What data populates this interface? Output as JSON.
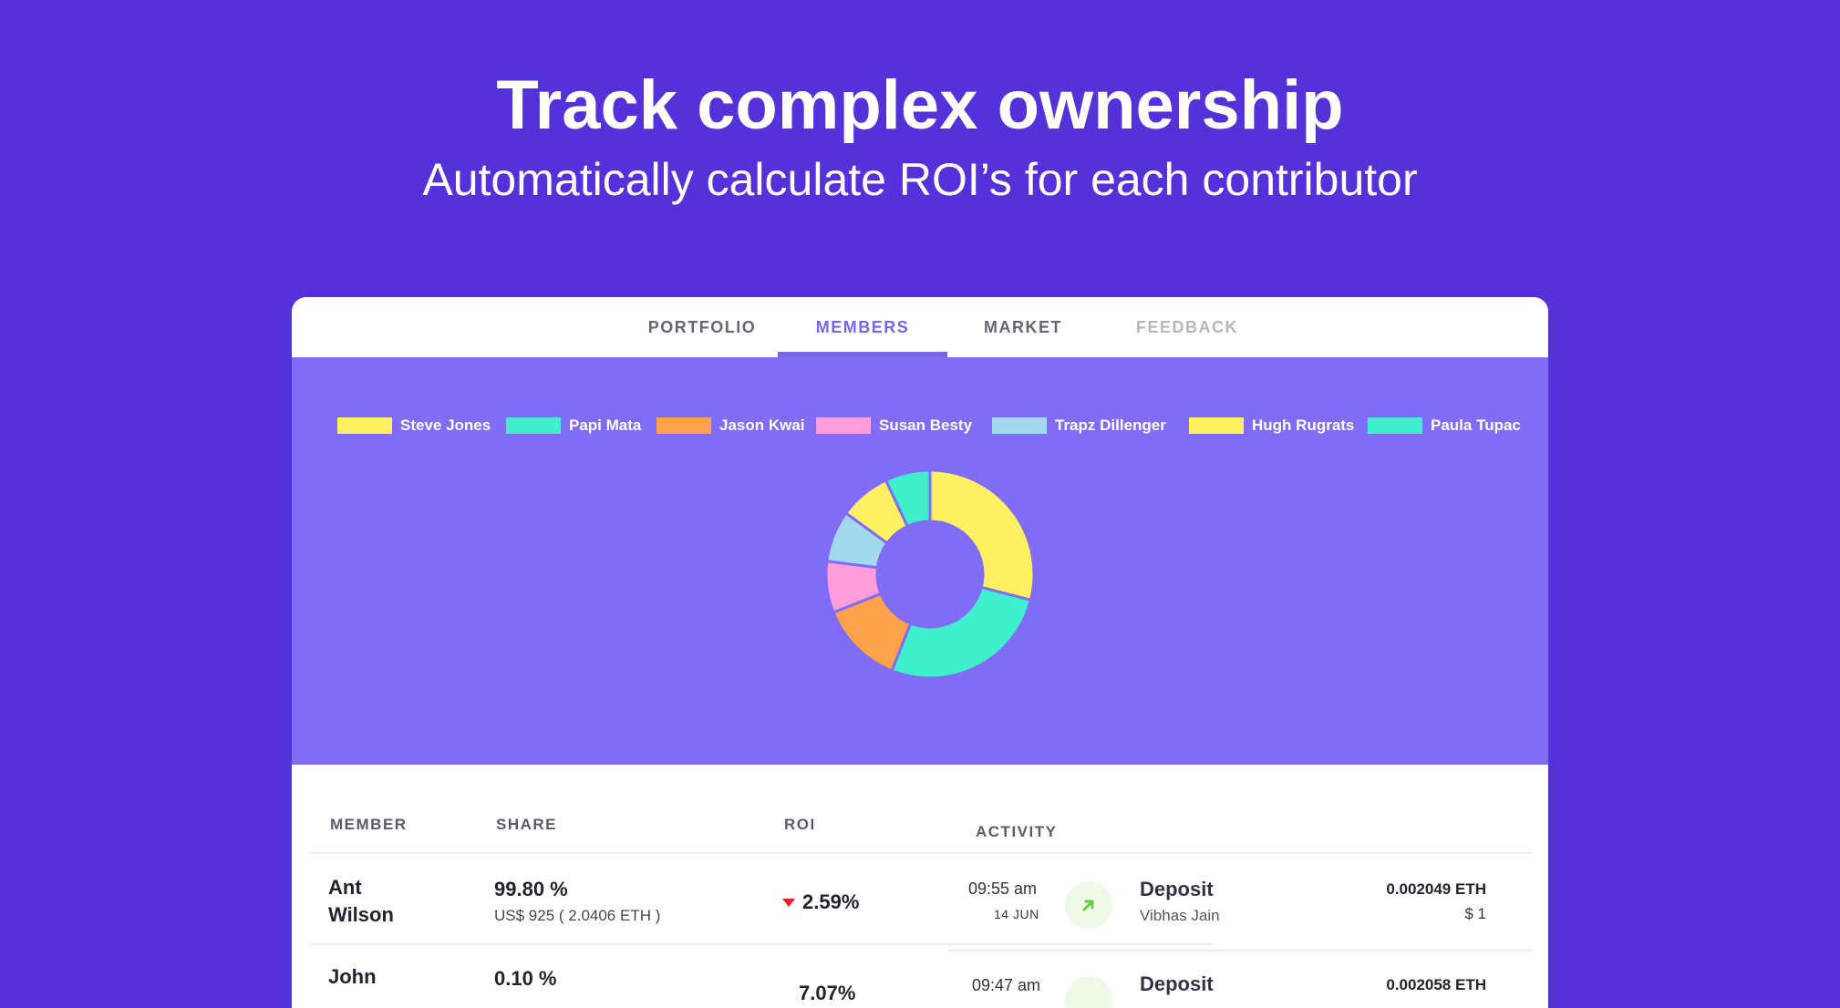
{
  "hero": {
    "title": "Track complex ownership",
    "subtitle": "Automatically calculate ROI’s for each contributor"
  },
  "tabs": [
    {
      "label": "PORTFOLIO"
    },
    {
      "label": "MEMBERS",
      "active": true
    },
    {
      "label": "MARKET"
    },
    {
      "label": "FEEDBACK",
      "muted": true
    }
  ],
  "colors": {
    "background": "#5431d8",
    "accent": "#7b63ef",
    "panel": "#806cf5",
    "roi_down": "#e0202a",
    "deposit_arrow": "#66cc44"
  },
  "chart_data": {
    "type": "pie",
    "variant": "donut",
    "legend_position": "top",
    "series": [
      {
        "name": "Steve Jones",
        "value": 29,
        "color": "#fff064"
      },
      {
        "name": "Papi Mata",
        "value": 27,
        "color": "#3ef0cc"
      },
      {
        "name": "Jason Kwai",
        "value": 13,
        "color": "#ffa24c"
      },
      {
        "name": "Susan Besty",
        "value": 8,
        "color": "#ff9ed8"
      },
      {
        "name": "Trapz Dillenger",
        "value": 8,
        "color": "#a3d9ee"
      },
      {
        "name": "Hugh Rugrats",
        "value": 8,
        "color": "#fff064"
      },
      {
        "name": "Paula Tupac",
        "value": 7,
        "color": "#3ef0cc"
      }
    ]
  },
  "members": {
    "headers": {
      "member": "MEMBER",
      "share": "SHARE",
      "roi": "ROI"
    },
    "rows": [
      {
        "first": "Ant",
        "last": "Wilson",
        "share_pct": "99.80 %",
        "share_detail": "US$ 925 ( 2.0406 ETH )",
        "roi": "2.59%"
      },
      {
        "first": "John",
        "last": "",
        "share_pct": "0.10 %",
        "share_detail": "",
        "roi": "7.07%"
      }
    ]
  },
  "activity": {
    "header": "ACTIVITY",
    "items": [
      {
        "time": "09:55 am",
        "date": "14 JUN",
        "icon": "arrow-up-right-icon",
        "title": "Deposit",
        "who": "Vibhas Jain",
        "amount": "0.002049 ETH",
        "usd": "$ 1"
      },
      {
        "time": "09:47 am",
        "date": "",
        "icon": "arrow-up-right-icon",
        "title": "Deposit",
        "who": "",
        "amount": "0.002058 ETH",
        "usd": ""
      }
    ]
  }
}
